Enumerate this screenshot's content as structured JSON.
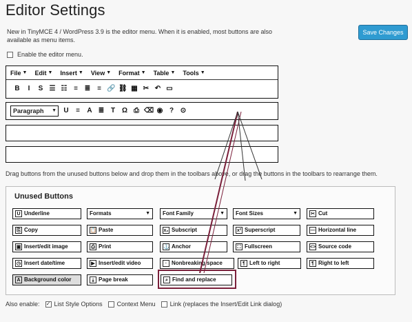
{
  "page": {
    "title": "Editor Settings",
    "intro": "New in TinyMCE 4 / WordPress 3.9 is the editor menu. When it is enabled, most buttons are also available as menu items.",
    "save_label": "Save Changes",
    "enable_menu_label": "Enable the editor menu.",
    "drag_help": "Drag buttons from the unused buttons below and drop them in the toolbars above, or drag the buttons in the toolbars to rearrange them."
  },
  "menu": {
    "items": [
      {
        "label": "File"
      },
      {
        "label": "Edit"
      },
      {
        "label": "Insert"
      },
      {
        "label": "View"
      },
      {
        "label": "Format"
      },
      {
        "label": "Table"
      },
      {
        "label": "Tools"
      }
    ]
  },
  "toolbar1": {
    "icons": [
      "B",
      "I",
      "S",
      "☰",
      "☷",
      "≡",
      "≣",
      "≡",
      "🔗",
      "⛓",
      "▦",
      "✂",
      "↶",
      "▭"
    ]
  },
  "toolbar2": {
    "format_select": "Paragraph",
    "icons": [
      "U",
      "≡",
      "A",
      "≣",
      "T",
      "Ω",
      "⎙",
      "⌫",
      "◉",
      "?",
      "⊙"
    ]
  },
  "unused": {
    "title": "Unused Buttons",
    "buttons": [
      {
        "label": "Underline",
        "icon": "U",
        "dropdown": false
      },
      {
        "label": "Formats",
        "icon": "",
        "dropdown": true
      },
      {
        "label": "Font Family",
        "icon": "",
        "dropdown": true
      },
      {
        "label": "Font Sizes",
        "icon": "",
        "dropdown": true
      },
      {
        "label": "Cut",
        "icon": "✂",
        "dropdown": false
      },
      {
        "label": "Copy",
        "icon": "⎘",
        "dropdown": false
      },
      {
        "label": "Paste",
        "icon": "📋",
        "dropdown": false
      },
      {
        "label": "Subscript",
        "icon": "x₂",
        "dropdown": false
      },
      {
        "label": "Superscript",
        "icon": "x²",
        "dropdown": false
      },
      {
        "label": "Horizontal line",
        "icon": "—",
        "dropdown": false
      },
      {
        "label": "Insert/edit image",
        "icon": "▣",
        "dropdown": false
      },
      {
        "label": "Print",
        "icon": "⎙",
        "dropdown": false
      },
      {
        "label": "Anchor",
        "icon": "⚓",
        "dropdown": false
      },
      {
        "label": "Fullscreen",
        "icon": "⛶",
        "dropdown": false
      },
      {
        "label": "Source code",
        "icon": "<>",
        "dropdown": false
      },
      {
        "label": "Insert date/time",
        "icon": "◷",
        "dropdown": false
      },
      {
        "label": "Insert/edit video",
        "icon": "▶",
        "dropdown": false
      },
      {
        "label": "Nonbreaking space",
        "icon": "·",
        "dropdown": false
      },
      {
        "label": "Left to right",
        "icon": "¶",
        "dropdown": false
      },
      {
        "label": "Right to left",
        "icon": "¶",
        "dropdown": false
      },
      {
        "label": "Background color",
        "icon": "A",
        "dropdown": false
      },
      {
        "label": "Page break",
        "icon": "⤓",
        "dropdown": false
      },
      {
        "label": "Find and replace",
        "icon": "⌕",
        "dropdown": false
      }
    ]
  },
  "also_enable": {
    "label": "Also enable:",
    "options": [
      {
        "label": "List Style Options",
        "checked": true
      },
      {
        "label": "Context Menu",
        "checked": false
      },
      {
        "label": "Link (replaces the Insert/Edit Link dialog)",
        "checked": false
      }
    ]
  },
  "colors": {
    "accent": "#2f9bd1",
    "highlight": "#7a1f3a"
  }
}
